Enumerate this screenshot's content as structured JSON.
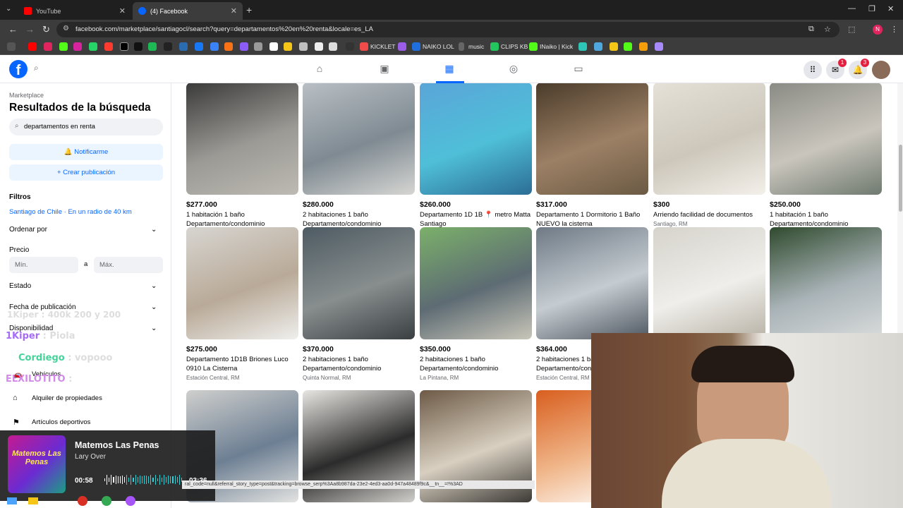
{
  "browser": {
    "tabs": [
      {
        "title": "YouTube",
        "active": false
      },
      {
        "title": "(4) Facebook",
        "active": true
      }
    ],
    "url": "facebook.com/marketplace/santiagocl/search?query=departamentos%20en%20renta&locale=es_LA",
    "profile_initial": "N",
    "bookmarks": [
      {
        "label": "KICKLET",
        "color": "#ef4b4b"
      },
      {
        "label": "NAIKO LOL",
        "color": "#1f6fde"
      },
      {
        "label": "music",
        "color": "#cccccc"
      },
      {
        "label": "CLIPS KB",
        "color": "#22c55e"
      },
      {
        "label": "INaiko | Kick",
        "color": "#53fc18"
      }
    ]
  },
  "facebook": {
    "logo": "f",
    "notifications": {
      "menu_badge": "1",
      "bell_badge": "3"
    }
  },
  "sidebar": {
    "breadcrumb": "Marketplace",
    "title": "Resultados de la búsqueda",
    "search_value": "departamentos en renta",
    "notify_label": "Notificarme",
    "create_label": "+ Crear publicación",
    "filters_label": "Filtros",
    "location": "Santiago de Chile · En un radio de 40 km",
    "sort_label": "Ordenar por",
    "price_label": "Precio",
    "min_placeholder": "Mín.",
    "max_placeholder": "Máx.",
    "price_separator": "a",
    "state_label": "Estado",
    "date_label": "Fecha de publicación",
    "availability_label": "Disponibilidad",
    "categories": [
      {
        "label": "Vehículos",
        "icon": "car-icon"
      },
      {
        "label": "Alquiler de propiedades",
        "icon": "house-icon"
      },
      {
        "label": "Artículos deportivos",
        "icon": "sports-icon"
      }
    ]
  },
  "listings": [
    {
      "price": "$277.000",
      "title": "1 habitación 1 baño Departamento/condominio",
      "location": "Cerrillos, RM"
    },
    {
      "price": "$280.000",
      "title": "2 habitaciones 1 baño Departamento/condominio",
      "location": "Estación Central, RM"
    },
    {
      "price": "$260.000",
      "title": "Departamento 1D 1B 📍 metro Matta Santiago",
      "location": "Santiago, RM"
    },
    {
      "price": "$317.000",
      "title": "Departamento 1 Dormitorio 1 Baño NUEVO la cisterna",
      "location": "Santiago, RM"
    },
    {
      "price": "$300",
      "title": "Arriendo facilidad de documentos",
      "location": "Santiago, RM"
    },
    {
      "price": "$250.000",
      "title": "1 habitación 1 baño Departamento/condominio",
      "location": "Santiago, RM"
    },
    {
      "price": "$275.000",
      "title": "Departamento 1D1B Briones Luco 0910 La Cisterna",
      "location": "Estación Central, RM"
    },
    {
      "price": "$370.000",
      "title": "2 habitaciones 1 baño Departamento/condominio",
      "location": "Quinta Normal, RM"
    },
    {
      "price": "$350.000",
      "title": "2 habitaciones 1 baño Departamento/condominio",
      "location": "La Pintana, RM"
    },
    {
      "price": "$364.000",
      "title": "2 habitaciones 1 baño Departamento/condominio",
      "location": "Estación Central, RM"
    },
    {
      "price": "",
      "title": "",
      "location": ""
    },
    {
      "price": "",
      "title": "",
      "location": ""
    },
    {
      "price": "",
      "title": "",
      "location": ""
    },
    {
      "price": "",
      "title": "",
      "location": ""
    },
    {
      "price": "",
      "title": "",
      "location": ""
    },
    {
      "price": "",
      "title": "",
      "location": ""
    }
  ],
  "stream_overlay": {
    "chat": [
      {
        "user": "1Kiper",
        "message": ": Piola",
        "color": "#a56cf5"
      },
      {
        "user": "Cordiego",
        "message": ": vopooo",
        "color": "#44d49a"
      },
      {
        "user": "ELXILOTITO",
        "message": ":",
        "color": "#d28be8"
      }
    ],
    "ghost_chat": "1Kiper : 400k 200 y 200",
    "music": {
      "song": "Matemos Las Penas",
      "artist": "Lary Over",
      "cover_text": "Matemos Las Penas",
      "elapsed": "00:58",
      "duration": "03:36",
      "progress": 0.27
    },
    "status_url": "ral_code=null&referral_story_type=post&tracking=browse_serp%3Aa8b987da-23e2-4ed3-aa0d-947a48489f9c&__tn__=!%3AD"
  }
}
